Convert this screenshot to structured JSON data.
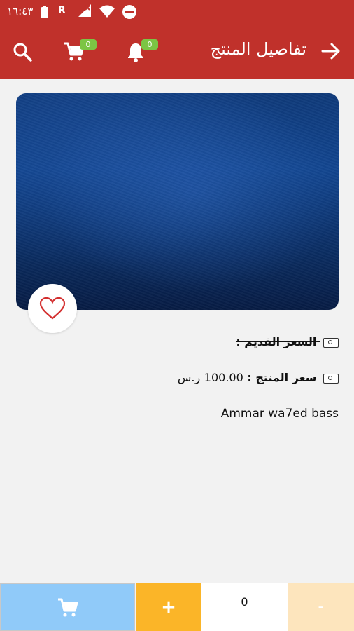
{
  "status_bar": {
    "time": "١٦:٤٣",
    "carrier_label": "R",
    "icons": [
      "battery-icon",
      "signal-off-icon",
      "wifi-icon",
      "do-not-disturb-icon"
    ]
  },
  "app_bar": {
    "title": "تفاصيل المنتج",
    "cart_badge": "0",
    "notifications_badge": "0",
    "icons": [
      "back-arrow-icon",
      "search-icon",
      "cart-icon",
      "bell-icon"
    ]
  },
  "product": {
    "old_price_label": "السعر القديم :",
    "price_label": "سعر المنتج :",
    "price_value": "100.00",
    "currency": "ر.س",
    "description": "Ammar wa7ed bass"
  },
  "bottom_bar": {
    "plus_label": "+",
    "quantity": "0",
    "minus_label": "-"
  },
  "colors": {
    "primary": "#c0312b",
    "cart_button": "#90caf9",
    "plus_button": "#fbb528",
    "minus_button": "#fde5bd",
    "badge": "#7cc544"
  }
}
